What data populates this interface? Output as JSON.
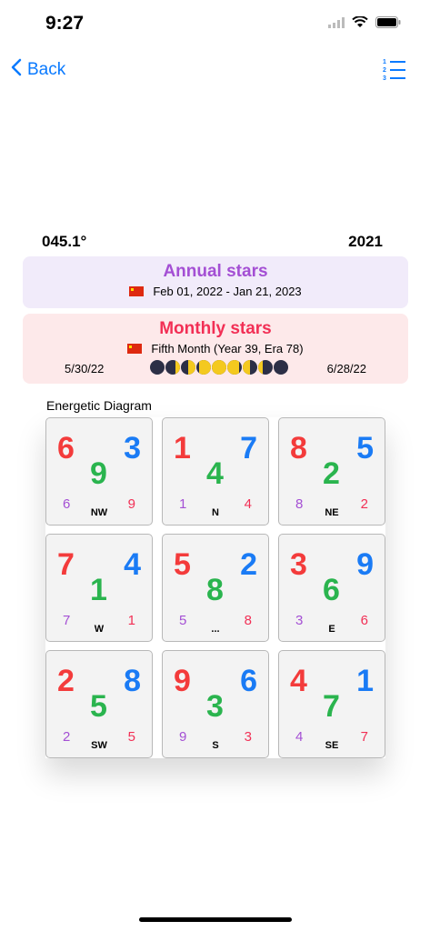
{
  "status": {
    "time": "9:27"
  },
  "nav": {
    "back_label": "Back"
  },
  "header": {
    "bearing": "045.1°",
    "year": "2021"
  },
  "annual": {
    "title": "Annual stars",
    "dates": "Feb 01, 2022 - Jan 21, 2023"
  },
  "monthly": {
    "title": "Monthly stars",
    "subtitle": "Fifth Month (Year 39, Era 78)",
    "start": "5/30/22",
    "end": "6/28/22",
    "moon_phases": [
      "new",
      "waxing-crescent",
      "first-quarter",
      "waxing-gibbous",
      "full",
      "waning-gibbous",
      "last-quarter",
      "waning-crescent",
      "new"
    ]
  },
  "diagram": {
    "label": "Energetic Diagram",
    "cells": [
      {
        "tl": "6",
        "tr": "3",
        "center": "9",
        "bl": "6",
        "br": "9",
        "dir": "NW"
      },
      {
        "tl": "1",
        "tr": "7",
        "center": "4",
        "bl": "1",
        "br": "4",
        "dir": "N"
      },
      {
        "tl": "8",
        "tr": "5",
        "center": "2",
        "bl": "8",
        "br": "2",
        "dir": "NE"
      },
      {
        "tl": "7",
        "tr": "4",
        "center": "1",
        "bl": "7",
        "br": "1",
        "dir": "W"
      },
      {
        "tl": "5",
        "tr": "2",
        "center": "8",
        "bl": "5",
        "br": "8",
        "dir": "..."
      },
      {
        "tl": "3",
        "tr": "9",
        "center": "6",
        "bl": "3",
        "br": "6",
        "dir": "E"
      },
      {
        "tl": "2",
        "tr": "8",
        "center": "5",
        "bl": "2",
        "br": "5",
        "dir": "SW"
      },
      {
        "tl": "9",
        "tr": "6",
        "center": "3",
        "bl": "9",
        "br": "3",
        "dir": "S"
      },
      {
        "tl": "4",
        "tr": "1",
        "center": "7",
        "bl": "4",
        "br": "7",
        "dir": "SE"
      }
    ]
  },
  "colors": {
    "accent": "#0a7aff",
    "annual_title": "#a44fd4",
    "monthly_title": "#f22f55",
    "red": "#f33b3b",
    "blue": "#1a7bf5",
    "green": "#2ab44e"
  }
}
